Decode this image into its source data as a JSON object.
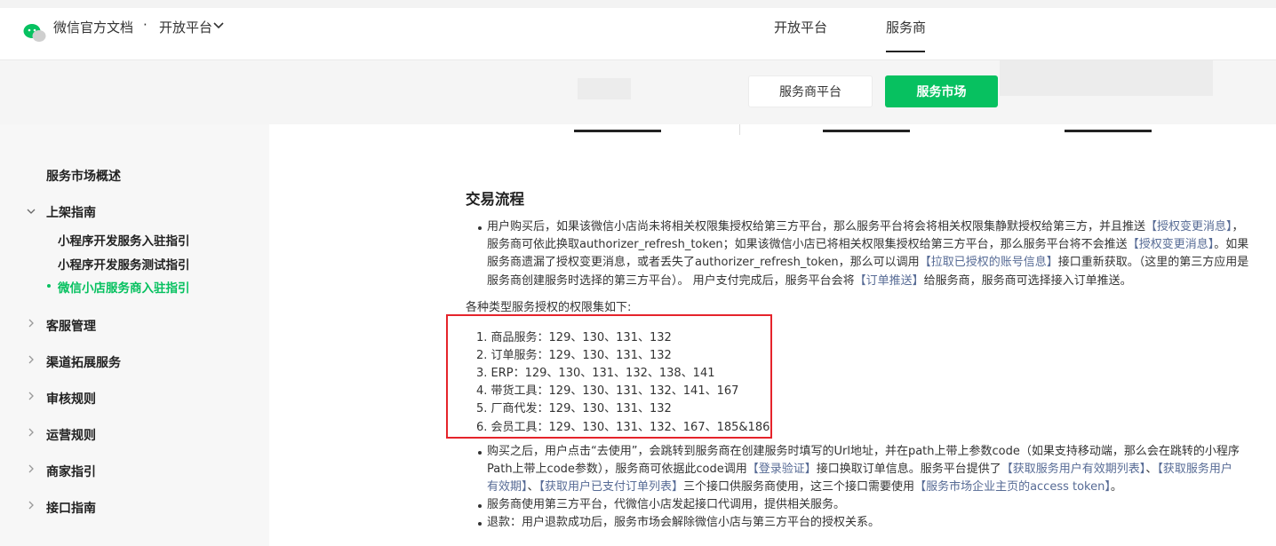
{
  "header": {
    "brand": "微信官方文档",
    "separator": "·",
    "platform": "开放平台",
    "tabs": [
      {
        "label": "开放平台"
      },
      {
        "label": "服务商"
      }
    ]
  },
  "subnav": {
    "platform_button": "服务商平台",
    "market_button": "服务市场"
  },
  "sidebar": {
    "overview": "服务市场概述",
    "listing": "上架指南",
    "listing_children": [
      "小程序开发服务入驻指引",
      "小程序开发服务测试指引",
      "微信小店服务商入驻指引"
    ],
    "items": [
      "客服管理",
      "渠道拓展服务",
      "审核规则",
      "运营规则",
      "商家指引",
      "接口指南"
    ]
  },
  "content": {
    "section_title": "交易流程",
    "p1": {
      "l1a": "用户购买后，如果该微信小店尚未将相关权限集授权给第三方平台，那么服务平台将会将相关权限集静默授权给第三方，并且推送",
      "l1link": "【授权变更消息】",
      "l1b": "，",
      "l2a": "服务商可依此换取authorizer_refresh_token；如果该微信小店已将相关权限集授权给第三方平台，那么服务平台将不会推送",
      "l2link": "【授权变更消息】",
      "l2b": "。如果",
      "l3a": "服务商遗漏了授权变更消息，或者丢失了authorizer_refresh_token，那么可以调用",
      "l3link": "【拉取已授权的账号信息】",
      "l3b": "接口重新获取。（这里的第三方应用是",
      "l4a": "服务商创建服务时选择的第三方平台）。 用户支付完成后，服务平台会将",
      "l4link": "【订单推送】",
      "l4b": "给服务商，服务商可选择接入订单推送。"
    },
    "perm_intro": "各种类型服务授权的权限集如下:",
    "perm_list": [
      "1. 商品服务：129、130、131、132",
      "2. 订单服务：129、130、131、132",
      "3. ERP：129、130、131、132、138、141",
      "4. 带货工具：129、130、131、132、141、167",
      "5. 厂商代发：129、130、131、132",
      "6. 会员工具：129、130、131、132、167、185&186"
    ],
    "p2": {
      "l1": "购买之后，用户点击“去使用”，会跳转到服务商在创建服务时填写的Url地址，并在path上带上参数code（如果支持移动端，那么会在跳转的小程序",
      "l2a": "Path上带上code参数），服务商可依据此code调用",
      "l2link1": "【登录验证】",
      "l2b": "接口换取订单信息。服务平台提供了",
      "l2link2": "【获取服务用户有效期列表】",
      "l2c": "、",
      "l2link3": "【获取服务用户",
      "l3link3": "有效期】",
      "l3a": "、",
      "l3link4": "【获取用户已支付订单列表】",
      "l3b": "三个接口供服务商使用，这三个接口需要使用",
      "l3link5": "【服务市场企业主页的access token】",
      "l3c": "。"
    },
    "p3": "服务商使用第三方平台，代微信小店发起接口代调用，提供相关服务。",
    "p4": "退款：用户退款成功后，服务市场会解除微信小店与第三方平台的授权关系。"
  },
  "colors": {
    "accent": "#07c160",
    "link": "#576b95",
    "highlight_box": "#e5242b"
  }
}
